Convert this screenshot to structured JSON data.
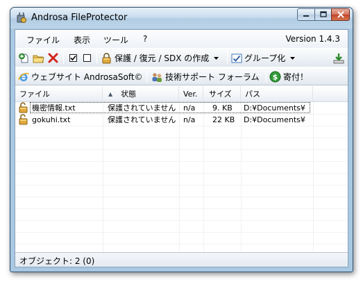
{
  "window": {
    "title": "Androsa FileProtector",
    "minimize_icon": "minimize-icon",
    "maximize_icon": "maximize-icon",
    "close_icon": "close-icon"
  },
  "menu": {
    "items": [
      "ファイル",
      "表示",
      "ツール",
      "?"
    ],
    "version": "Version 1.4.3"
  },
  "toolbar1": {
    "add_icon": "add-file-icon",
    "open_icon": "folder-icon",
    "delete_icon": "delete-icon",
    "check_all_icon": "checkbox-checked-icon",
    "uncheck_all_icon": "checkbox-empty-icon",
    "protect_label": "保護 / 復元 / SDX の作成",
    "group_label": "グループ化",
    "download_icon": "download-icon"
  },
  "toolbar2": {
    "website_label": "ウェブサイト AndrosaSoft©",
    "support_label": "技術サポート フォーラム",
    "donate_label": "寄付！"
  },
  "table": {
    "columns": [
      "ファイル",
      "状態",
      "Ver.",
      "サイズ",
      "パス"
    ],
    "sort_indicator": "▲",
    "rows": [
      {
        "file": "機密情報.txt",
        "status": "保護されていません",
        "ver": "n/a",
        "size": "9. KB",
        "path": "D:¥Documents¥"
      },
      {
        "file": "gokuhi.txt",
        "status": "保護されていません",
        "ver": "n/a",
        "size": "22 KB",
        "path": "D:¥Documents¥"
      }
    ]
  },
  "status": {
    "text": "オブジェクト: 2 (0)"
  },
  "colors": {
    "titlebar": "#c9ddee",
    "close_button": "#c2452b",
    "lock_icon": "#c9882a",
    "donate_green": "#2e9a35"
  }
}
